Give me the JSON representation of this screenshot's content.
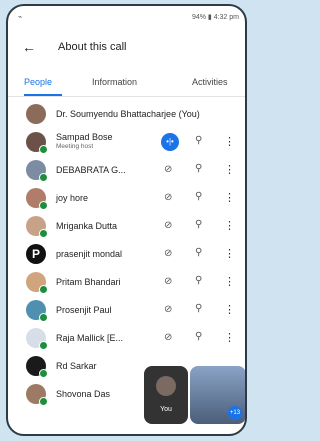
{
  "status_bar": {
    "left": "⌁",
    "right": "94% ▮ 4:32 pm"
  },
  "header": {
    "title": "About this call"
  },
  "tabs": [
    {
      "label": "People"
    },
    {
      "label": "Information"
    },
    {
      "label": "Activities"
    }
  ],
  "participants": [
    {
      "name": "Dr. Soumyendu Bhattacharjee (You)",
      "subtitle": ""
    },
    {
      "name": "Sampad Bose",
      "subtitle": "Meeting host"
    },
    {
      "name": "DEBABRATA G...",
      "subtitle": ""
    },
    {
      "name": "joy hore",
      "subtitle": ""
    },
    {
      "name": "Mriganka Dutta",
      "subtitle": ""
    },
    {
      "name": "prasenjit mondal",
      "subtitle": ""
    },
    {
      "name": "Pritam Bhandari",
      "subtitle": ""
    },
    {
      "name": "Prosenjit Paul",
      "subtitle": ""
    },
    {
      "name": "Raja Mallick [E...",
      "subtitle": ""
    },
    {
      "name": "Rd Sarkar",
      "subtitle": ""
    },
    {
      "name": "Shovona Das",
      "subtitle": ""
    }
  ],
  "self_tile": {
    "label": "You"
  },
  "video_tile": {
    "badge": "+13"
  }
}
